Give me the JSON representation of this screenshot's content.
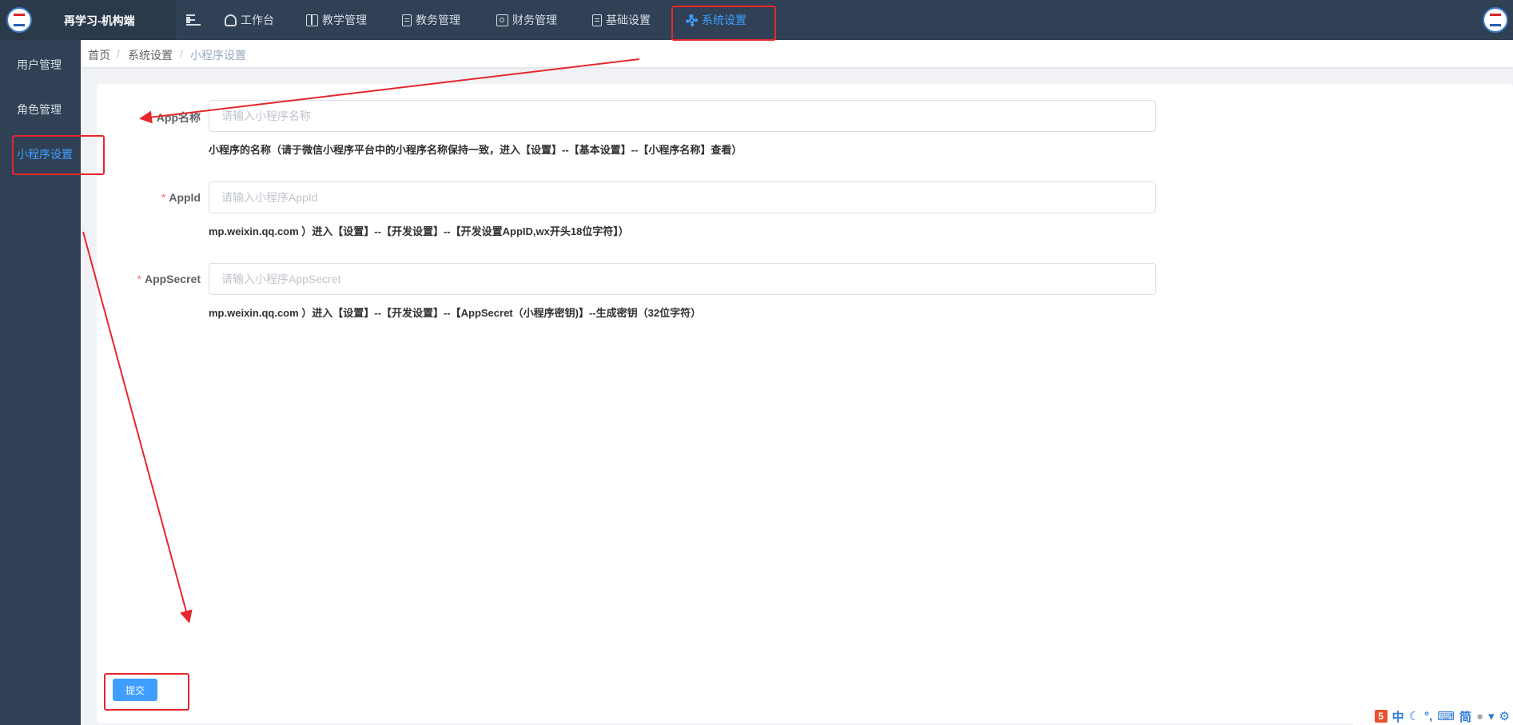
{
  "app": {
    "name": "再学习-机构端"
  },
  "topnav": [
    {
      "label": "工作台",
      "icon": "dashboard-icon"
    },
    {
      "label": "教学管理",
      "icon": "book-icon"
    },
    {
      "label": "教务管理",
      "icon": "document-icon"
    },
    {
      "label": "财务管理",
      "icon": "money-icon"
    },
    {
      "label": "基础设置",
      "icon": "document-icon"
    },
    {
      "label": "系统设置",
      "icon": "gear-icon",
      "active": true
    }
  ],
  "sidebar": {
    "items": [
      {
        "label": "用户管理"
      },
      {
        "label": "角色管理"
      },
      {
        "label": "小程序设置",
        "active": true
      }
    ]
  },
  "breadcrumb": [
    "首页",
    "系统设置",
    "小程序设置"
  ],
  "form": {
    "app_name": {
      "label": "App名称",
      "placeholder": "请输入小程序名称",
      "value": "",
      "help": "小程序的名称（请于微信小程序平台中的小程序名称保持一致，进入【设置】--【基本设置】--【小程序名称】查看）"
    },
    "app_id": {
      "required_mark": "*",
      "label": "AppId",
      "placeholder": "请输入小程序AppId",
      "value": "",
      "help": "mp.weixin.qq.com ）进入【设置】--【开发设置】--【开发设置AppID,wx开头18位字符】）"
    },
    "app_secret": {
      "required_mark": "*",
      "label": "AppSecret",
      "placeholder": "请输入小程序AppSecret",
      "value": "",
      "help": "mp.weixin.qq.com ）进入【设置】--【开发设置】--【AppSecret（小程序密钥)】--生成密钥（32位字符）"
    },
    "submit_label": "提交"
  },
  "ime_tray": {
    "lang": "中",
    "charset": "简"
  },
  "colors": {
    "topbar": "#304156",
    "accent": "#409eff",
    "annotation": "#e8262c"
  }
}
